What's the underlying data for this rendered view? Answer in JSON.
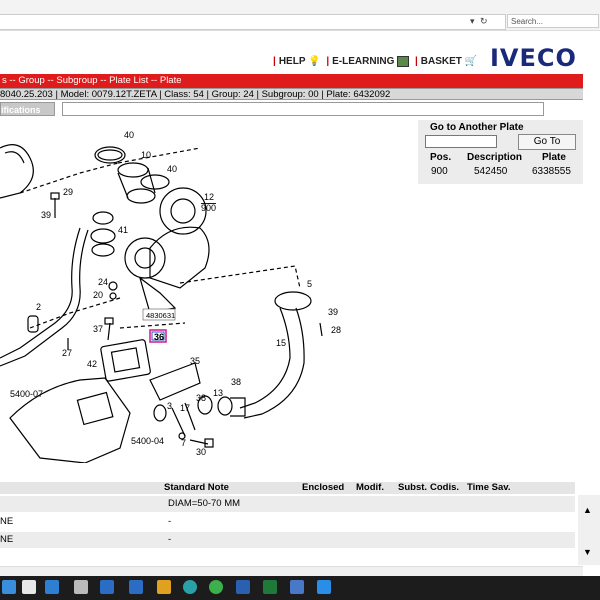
{
  "browser": {
    "address_tail": "▾ ♂ ¢",
    "search_placeholder": "Search..."
  },
  "header": {
    "help": "HELP",
    "elearning": "E-LEARNING",
    "basket": "BASKET",
    "logo": "IVECO"
  },
  "breadcrumb": "s -- Group -- Subgroup -- Plate List -- Plate",
  "info_line": "8040.25.203 | Model: 0079.12T.ZETA | Class: 54 | Group: 24 | Subgroup: 00 | Plate: 6432092",
  "spec_tab": "ifications",
  "goto_panel": {
    "title": "Go to Another Plate",
    "button": "Go To",
    "columns": [
      "Pos.",
      "Description",
      "Plate"
    ],
    "row": [
      "900",
      "542450",
      "6338555"
    ]
  },
  "diagram": {
    "tooltip": "4830631",
    "highlighted": "36",
    "labels": [
      "40",
      "10",
      "40",
      "29",
      "39",
      "41",
      "12",
      "900",
      "24",
      "20",
      "5",
      "2",
      "37",
      "39",
      "28",
      "27",
      "15",
      "42",
      "35",
      "5400-07",
      "3",
      "17",
      "38",
      "13",
      "38",
      "5400-04",
      "7",
      "30",
      "36"
    ]
  },
  "table": {
    "headers": [
      "Standard Note",
      "Enclosed",
      "Modif.",
      "Subst.",
      "Codis.",
      "Time Sav."
    ],
    "rows": [
      {
        "left": "",
        "note": "DIAM=50-70 MM"
      },
      {
        "left": "NE",
        "note": "-"
      },
      {
        "left": "NE",
        "note": "-"
      }
    ]
  }
}
